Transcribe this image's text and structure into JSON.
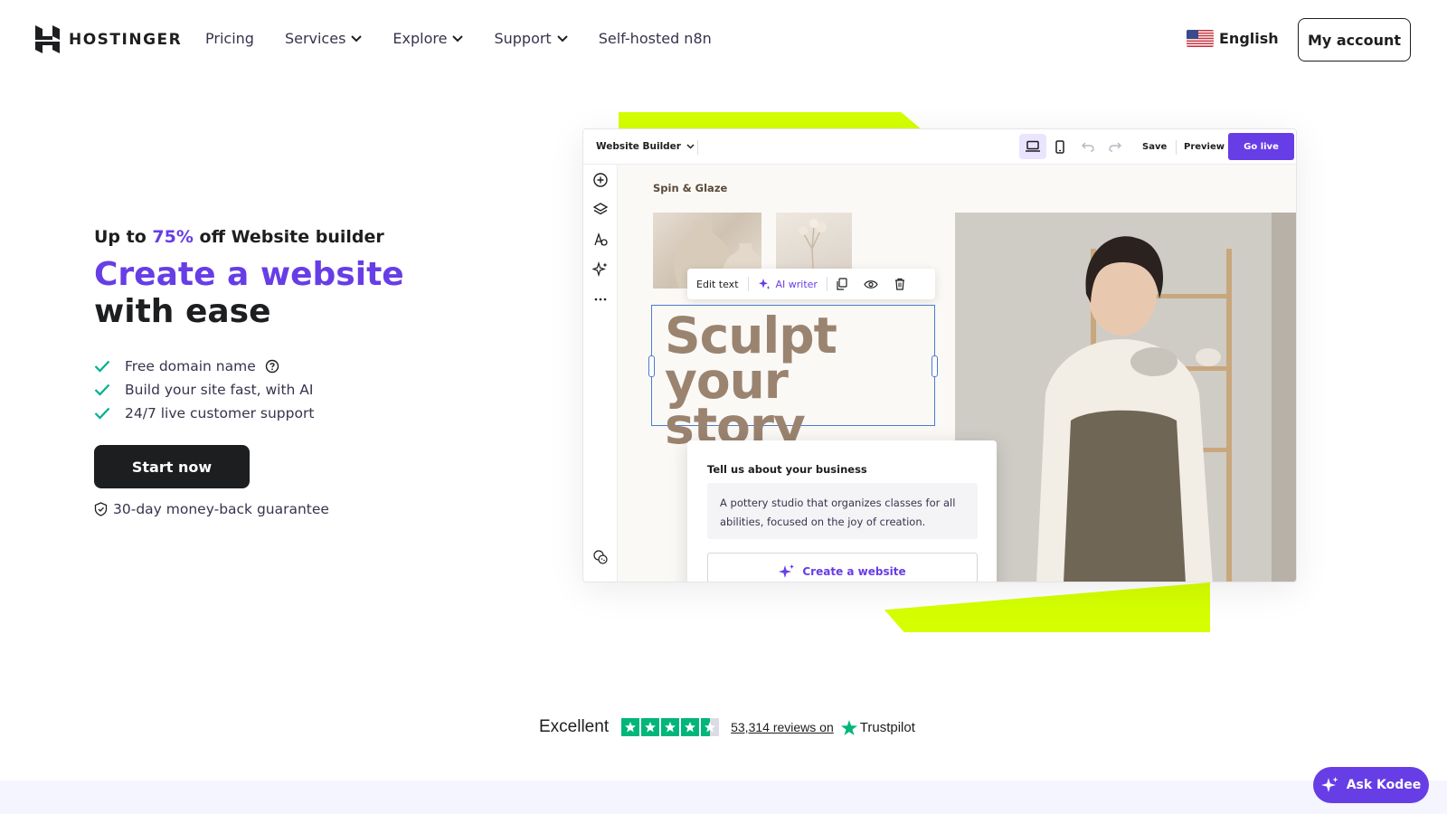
{
  "header": {
    "brand": "HOSTINGER",
    "nav": [
      {
        "label": "Pricing",
        "dropdown": false
      },
      {
        "label": "Services",
        "dropdown": true
      },
      {
        "label": "Explore",
        "dropdown": true
      },
      {
        "label": "Support",
        "dropdown": true
      },
      {
        "label": "Self-hosted n8n",
        "dropdown": false
      }
    ],
    "language": "English",
    "account_button": "My account"
  },
  "hero": {
    "promo_prefix": "Up to",
    "promo_discount": "75%",
    "promo_suffix": "off Website builder",
    "headline_accent": "Create a website",
    "headline_rest": "with ease",
    "features": [
      "Free domain name",
      "Build your site fast, with AI",
      "24/7 live customer support"
    ],
    "cta": "Start now",
    "guarantee": "30-day money-back guarantee"
  },
  "builder": {
    "title": "Website Builder",
    "save": "Save",
    "preview": "Preview",
    "go_live": "Go live",
    "site_name": "Spin & Glaze",
    "edit_text": "Edit text",
    "ai_writer": "AI writer",
    "heading_line1": "Sculpt",
    "heading_line2": "your story",
    "prompt_label": "Tell us about your business",
    "prompt_value": "A pottery studio that organizes classes for all abilities, focused on the joy of creation.",
    "create_button": "Create a website"
  },
  "trust": {
    "rating_word": "Excellent",
    "rating_stars": 4.5,
    "reviews": "53,314 reviews on",
    "provider": "Trustpilot"
  },
  "chat": {
    "label": "Ask Kodee"
  },
  "colors": {
    "accent": "#673de6",
    "lime": "#d5ff01",
    "dark": "#1d1e20",
    "check": "#00b090",
    "trustpilot": "#00b67a"
  }
}
